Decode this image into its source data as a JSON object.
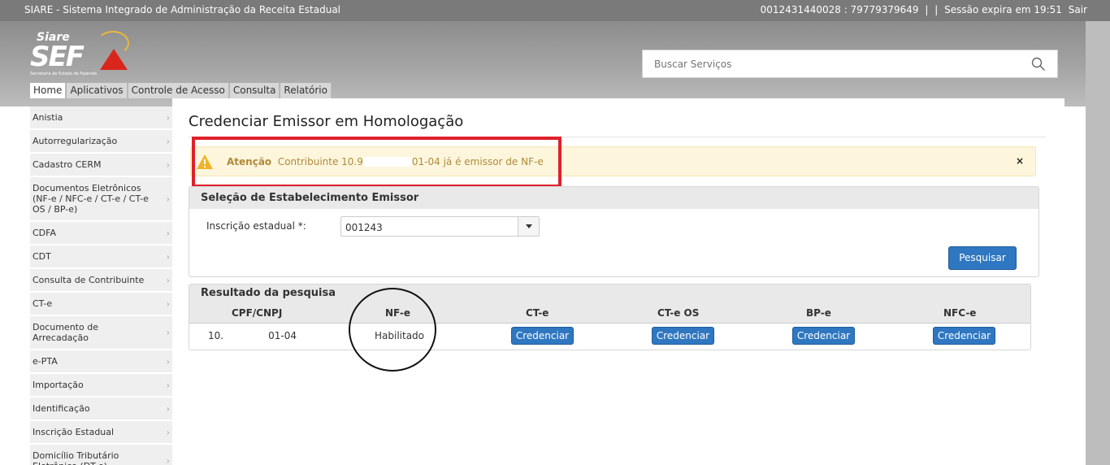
{
  "topbar": {
    "title": "SIARE - Sistema Integrado de Administração da Receita Estadual",
    "ids": "0012431440028 : 79779379649",
    "sep1": "|",
    "sep2": "|",
    "session": "Sessão expira em 19:51",
    "logout": "Sair"
  },
  "logo": {
    "top": "Siare",
    "main": "SEF",
    "sub": "Secretaria de Estado de Fazenda"
  },
  "search": {
    "placeholder": "Buscar Serviços"
  },
  "menu": [
    "Home",
    "Aplicativos",
    "Controle de Acesso",
    "Consulta",
    "Relatório"
  ],
  "sidebar": [
    "Anistia",
    "Autorregularização",
    "Cadastro CERM",
    "Documentos Eletrônicos (NF-e / NFC-e / CT-e / CT-e OS / BP-e)",
    "CDFA",
    "CDT",
    "Consulta de Contribuinte",
    "CT-e",
    "Documento de Arrecadação",
    "e-PTA",
    "Importação",
    "Identificação",
    "Inscrição Estadual",
    "Domicílio Tributário Eletrônico (DT-e)"
  ],
  "page": {
    "title": "Credenciar Emissor em Homologação"
  },
  "alert": {
    "strong": "Atenção",
    "msg_start": "Contribuinte 10.9",
    "msg_end": "01-04 já é emissor de NF-e",
    "close": "×"
  },
  "selection": {
    "title": "Seleção de Estabelecimento Emissor",
    "label": "Inscrição estadual *:",
    "value": "001243",
    "button": "Pesquisar"
  },
  "result": {
    "title": "Resultado da pesquisa",
    "columns": [
      "CPF/CNPJ",
      "NF-e",
      "CT-e",
      "CT-e OS",
      "BP-e",
      "NFC-e"
    ],
    "row": {
      "cnpj_start": "10.",
      "cnpj_end": "01-04",
      "nfe": "Habilitado",
      "btn": "Credenciar"
    }
  },
  "colors": {
    "accent": "#2f77c0",
    "alert_bg": "#fdf6dd",
    "highlight_box": "#e0202a"
  }
}
